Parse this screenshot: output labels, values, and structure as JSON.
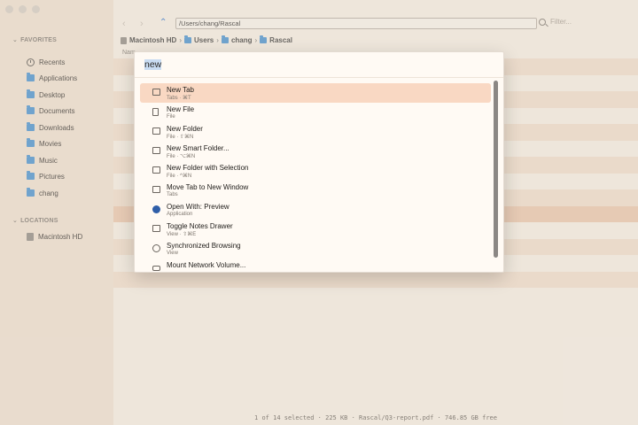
{
  "toolbar": {
    "path_value": "/Users/chang/Rascal",
    "filter_placeholder": "Filter..."
  },
  "breadcrumb": [
    "Macintosh HD",
    "Users",
    "chang",
    "Rascal"
  ],
  "column_header": "Nam",
  "sidebar": {
    "favorites_header": "FAVORITES",
    "favorites": [
      {
        "label": "Recents",
        "icon": "clock-icon"
      },
      {
        "label": "Applications",
        "icon": "folder-icon"
      },
      {
        "label": "Desktop",
        "icon": "folder-icon"
      },
      {
        "label": "Documents",
        "icon": "folder-icon"
      },
      {
        "label": "Downloads",
        "icon": "folder-icon"
      },
      {
        "label": "Movies",
        "icon": "folder-icon"
      },
      {
        "label": "Music",
        "icon": "folder-icon"
      },
      {
        "label": "Pictures",
        "icon": "folder-icon"
      },
      {
        "label": "chang",
        "icon": "folder-icon"
      }
    ],
    "locations_header": "LOCATIONS",
    "locations": [
      {
        "label": "Macintosh HD",
        "icon": "disk-icon"
      }
    ]
  },
  "palette": {
    "query": "new",
    "results": [
      {
        "title": "New Tab",
        "subtitle": "Tabs · ⌘T",
        "icon": "new-tab-icon",
        "active": true
      },
      {
        "title": "New File",
        "subtitle": "File",
        "icon": "new-file-icon"
      },
      {
        "title": "New Folder",
        "subtitle": "File · ⇧⌘N",
        "icon": "new-folder-icon"
      },
      {
        "title": "New Smart Folder...",
        "subtitle": "File · ⌥⌘N",
        "icon": "smart-folder-icon"
      },
      {
        "title": "New Folder with Selection",
        "subtitle": "File · ^⌘N",
        "icon": "folder-selection-icon"
      },
      {
        "title": "Move Tab to New Window",
        "subtitle": "Tabs",
        "icon": "move-tab-icon"
      },
      {
        "title": "Open With: Preview",
        "subtitle": "Application",
        "icon": "preview-app-icon"
      },
      {
        "title": "Toggle Notes Drawer",
        "subtitle": "View · ⇧⌘E",
        "icon": "notes-drawer-icon"
      },
      {
        "title": "Synchronized Browsing",
        "subtitle": "View",
        "icon": "sync-icon"
      },
      {
        "title": "Mount Network Volume...",
        "subtitle": "",
        "icon": "network-drive-icon"
      }
    ]
  },
  "status": "1 of 14 selected  ·  225 KB  ·  Rascal/Q3-report.pdf  ·  746.85 GB free"
}
